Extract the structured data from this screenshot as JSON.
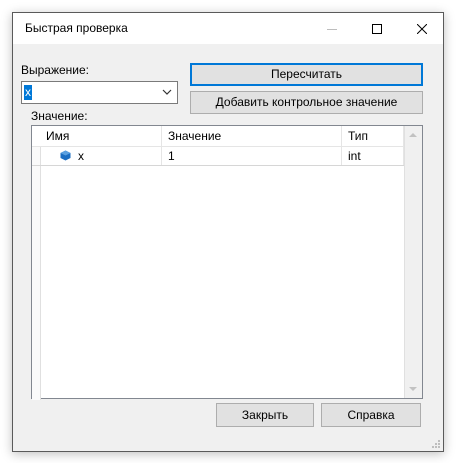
{
  "window": {
    "title": "Быстрая проверка"
  },
  "expression": {
    "label": "Выражение:",
    "value": "x"
  },
  "buttons": {
    "recalculate": "Пересчитать",
    "add_watch": "Добавить контрольное значение",
    "close": "Закрыть",
    "help": "Справка"
  },
  "value_label": "Значение:",
  "grid": {
    "columns": [
      "Имя",
      "Значение",
      "Тип"
    ],
    "rows": [
      {
        "name": "x",
        "value": "1",
        "type": "int",
        "icon": "variable-icon"
      }
    ]
  },
  "colors": {
    "accent": "#0078d7",
    "variable_icon": "#1b6ec2"
  }
}
